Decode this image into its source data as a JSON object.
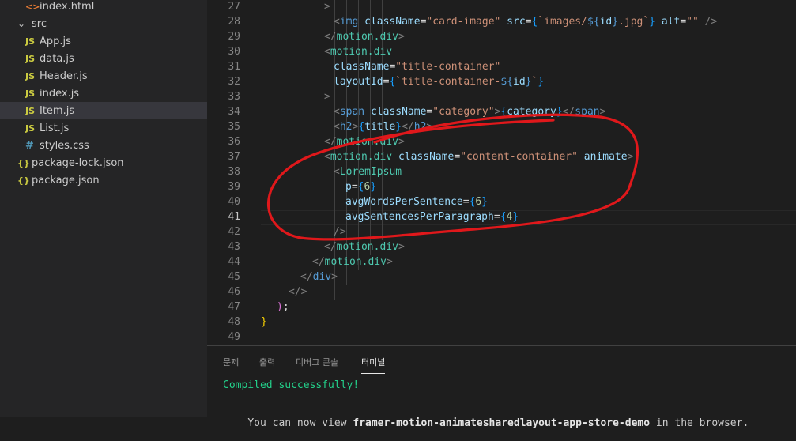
{
  "sidebar": {
    "items": [
      {
        "icon": "<>",
        "label": "index.html"
      },
      {
        "icon": "chevron-down",
        "label": "src"
      },
      {
        "icon": "JS",
        "label": "App.js"
      },
      {
        "icon": "JS",
        "label": "data.js"
      },
      {
        "icon": "JS",
        "label": "Header.js"
      },
      {
        "icon": "JS",
        "label": "index.js"
      },
      {
        "icon": "JS",
        "label": "Item.js"
      },
      {
        "icon": "JS",
        "label": "List.js"
      },
      {
        "icon": "#",
        "label": "styles.css"
      },
      {
        "icon": "{}",
        "label": "package-lock.json"
      },
      {
        "icon": "{}",
        "label": "package.json"
      }
    ]
  },
  "editor": {
    "current_line": "41",
    "lines": [
      {
        "n": "27",
        "t": [
          [
            ">",
            "t-br"
          ]
        ]
      },
      {
        "n": "28",
        "t": [
          [
            "<",
            "t-br"
          ],
          [
            "img",
            "t-tag"
          ],
          [
            " ",
            "t-p"
          ],
          [
            "className",
            "t-attr"
          ],
          [
            "=",
            "t-p"
          ],
          [
            "\"card-image\"",
            "t-str"
          ],
          [
            " ",
            "t-p"
          ],
          [
            "src",
            "t-attr"
          ],
          [
            "=",
            "t-p"
          ],
          [
            "{",
            "t-b"
          ],
          [
            "`images/",
            "t-str"
          ],
          [
            "${",
            "t-kw"
          ],
          [
            "id",
            "t-attr"
          ],
          [
            "}",
            "t-kw"
          ],
          [
            ".jpg`",
            "t-str"
          ],
          [
            "}",
            "t-b"
          ],
          [
            " ",
            "t-p"
          ],
          [
            "alt",
            "t-attr"
          ],
          [
            "=",
            "t-p"
          ],
          [
            "\"\"",
            "t-str"
          ],
          [
            " />",
            "t-br"
          ]
        ]
      },
      {
        "n": "29",
        "t": [
          [
            "</",
            "t-br"
          ],
          [
            "motion.div",
            "t-comp"
          ],
          [
            ">",
            "t-br"
          ]
        ]
      },
      {
        "n": "30",
        "t": [
          [
            "<",
            "t-br"
          ],
          [
            "motion.div",
            "t-comp"
          ]
        ]
      },
      {
        "n": "31",
        "t": [
          [
            "className",
            "t-attr"
          ],
          [
            "=",
            "t-p"
          ],
          [
            "\"title-container\"",
            "t-str"
          ]
        ]
      },
      {
        "n": "32",
        "t": [
          [
            "layoutId",
            "t-attr"
          ],
          [
            "=",
            "t-p"
          ],
          [
            "{",
            "t-b"
          ],
          [
            "`title-container-",
            "t-str"
          ],
          [
            "${",
            "t-kw"
          ],
          [
            "id",
            "t-attr"
          ],
          [
            "}",
            "t-kw"
          ],
          [
            "`",
            "t-str"
          ],
          [
            "}",
            "t-b"
          ]
        ]
      },
      {
        "n": "33",
        "t": [
          [
            ">",
            "t-br"
          ]
        ]
      },
      {
        "n": "34",
        "t": [
          [
            "<",
            "t-br"
          ],
          [
            "span",
            "t-tag"
          ],
          [
            " ",
            "t-p"
          ],
          [
            "className",
            "t-attr"
          ],
          [
            "=",
            "t-p"
          ],
          [
            "\"category\"",
            "t-str"
          ],
          [
            ">",
            "t-br"
          ],
          [
            "{",
            "t-b"
          ],
          [
            "category",
            "t-attr"
          ],
          [
            "}",
            "t-b"
          ],
          [
            "</",
            "t-br"
          ],
          [
            "span",
            "t-tag"
          ],
          [
            ">",
            "t-br"
          ]
        ]
      },
      {
        "n": "35",
        "t": [
          [
            "<",
            "t-br"
          ],
          [
            "h2",
            "t-tag"
          ],
          [
            ">",
            "t-br"
          ],
          [
            "{",
            "t-b"
          ],
          [
            "title",
            "t-attr"
          ],
          [
            "}",
            "t-b"
          ],
          [
            "</",
            "t-br"
          ],
          [
            "h2",
            "t-tag"
          ],
          [
            ">",
            "t-br"
          ]
        ]
      },
      {
        "n": "36",
        "t": [
          [
            "</",
            "t-br"
          ],
          [
            "motion.div",
            "t-comp"
          ],
          [
            ">",
            "t-br"
          ]
        ]
      },
      {
        "n": "37",
        "t": [
          [
            "<",
            "t-br"
          ],
          [
            "motion.div",
            "t-comp"
          ],
          [
            " ",
            "t-p"
          ],
          [
            "className",
            "t-attr"
          ],
          [
            "=",
            "t-p"
          ],
          [
            "\"content-container\"",
            "t-str"
          ],
          [
            " ",
            "t-p"
          ],
          [
            "animate",
            "t-attr"
          ],
          [
            ">",
            "t-br"
          ]
        ]
      },
      {
        "n": "38",
        "t": [
          [
            "<",
            "t-br"
          ],
          [
            "LoremIpsum",
            "t-comp"
          ]
        ]
      },
      {
        "n": "39",
        "t": [
          [
            "p",
            "t-attr"
          ],
          [
            "=",
            "t-p"
          ],
          [
            "{",
            "t-b"
          ],
          [
            "6",
            "t-num"
          ],
          [
            "}",
            "t-b"
          ]
        ]
      },
      {
        "n": "40",
        "t": [
          [
            "avgWordsPerSentence",
            "t-attr"
          ],
          [
            "=",
            "t-p"
          ],
          [
            "{",
            "t-b"
          ],
          [
            "6",
            "t-num"
          ],
          [
            "}",
            "t-b"
          ]
        ]
      },
      {
        "n": "41",
        "t": [
          [
            "avgSentencesPerParagraph",
            "t-attr"
          ],
          [
            "=",
            "t-p"
          ],
          [
            "{",
            "t-b"
          ],
          [
            "4",
            "t-num"
          ],
          [
            "}",
            "t-b"
          ]
        ]
      },
      {
        "n": "42",
        "t": [
          [
            "/>",
            "t-br"
          ]
        ]
      },
      {
        "n": "43",
        "t": [
          [
            "</",
            "t-br"
          ],
          [
            "motion.div",
            "t-comp"
          ],
          [
            ">",
            "t-br"
          ]
        ]
      },
      {
        "n": "44",
        "t": [
          [
            "</",
            "t-br"
          ],
          [
            "motion.div",
            "t-comp"
          ],
          [
            ">",
            "t-br"
          ]
        ]
      },
      {
        "n": "45",
        "t": [
          [
            "</",
            "t-br"
          ],
          [
            "div",
            "t-tag"
          ],
          [
            ">",
            "t-br"
          ]
        ]
      },
      {
        "n": "46",
        "t": [
          [
            "</>",
            "t-br"
          ]
        ]
      },
      {
        "n": "47",
        "t": [
          [
            ")",
            "t-m"
          ],
          [
            ";",
            "t-p"
          ]
        ]
      },
      {
        "n": "48",
        "t": [
          [
            "}",
            "t-y"
          ]
        ]
      },
      {
        "n": "49",
        "t": []
      }
    ]
  },
  "panel": {
    "tabs": [
      "문제",
      "출력",
      "디버그 콘솔",
      "터미널"
    ],
    "active_tab": "터미널",
    "terminal": {
      "line1": "Compiled successfully!",
      "line2_prefix": "You can now view ",
      "line2_app": "framer-motion-animatesharedlayout-app-store-demo",
      "line2_suffix": " in the browser."
    }
  },
  "colors": {
    "annotation": "#e0181b",
    "background": "#1e1e1e",
    "sidebar": "#252526"
  }
}
